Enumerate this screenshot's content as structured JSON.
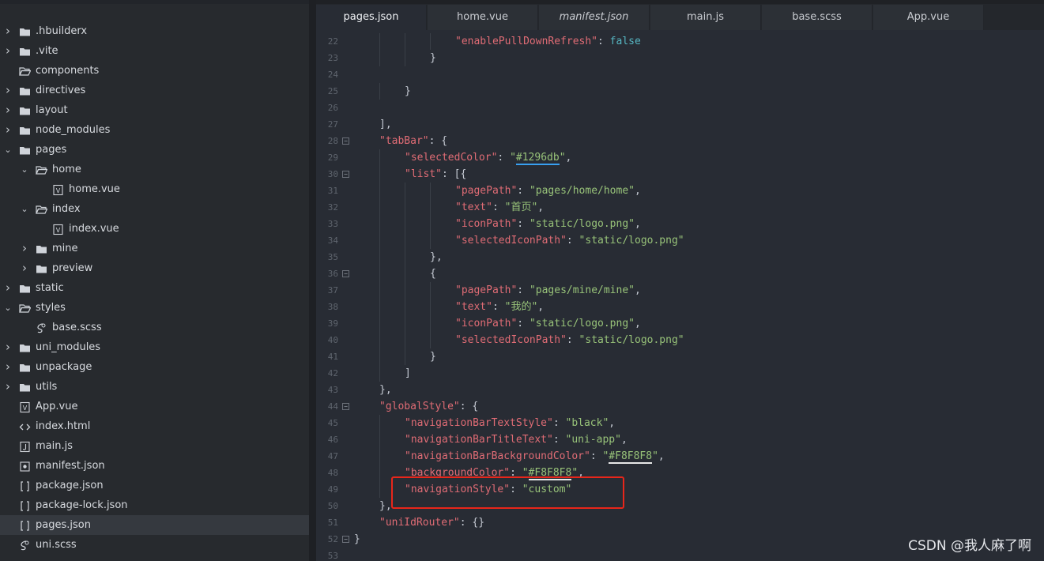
{
  "explorer": {
    "items": [
      {
        "label": ".hbuilderx",
        "type": "folder",
        "expand": "closed",
        "depth": 0
      },
      {
        "label": ".vite",
        "type": "folder",
        "expand": "closed",
        "depth": 0
      },
      {
        "label": "components",
        "type": "folder-open",
        "expand": "none",
        "depth": 0
      },
      {
        "label": "directives",
        "type": "folder",
        "expand": "closed",
        "depth": 0
      },
      {
        "label": "layout",
        "type": "folder",
        "expand": "closed",
        "depth": 0
      },
      {
        "label": "node_modules",
        "type": "folder",
        "expand": "closed",
        "depth": 0
      },
      {
        "label": "pages",
        "type": "folder",
        "expand": "open",
        "depth": 0
      },
      {
        "label": "home",
        "type": "folder-open",
        "expand": "open",
        "depth": 1
      },
      {
        "label": "home.vue",
        "type": "vue",
        "expand": "none",
        "depth": 2
      },
      {
        "label": "index",
        "type": "folder-open",
        "expand": "open",
        "depth": 1
      },
      {
        "label": "index.vue",
        "type": "vue",
        "expand": "none",
        "depth": 2
      },
      {
        "label": "mine",
        "type": "folder",
        "expand": "closed",
        "depth": 1
      },
      {
        "label": "preview",
        "type": "folder",
        "expand": "closed",
        "depth": 1
      },
      {
        "label": "static",
        "type": "folder",
        "expand": "closed",
        "depth": 0
      },
      {
        "label": "styles",
        "type": "folder-open",
        "expand": "open",
        "depth": 0
      },
      {
        "label": "base.scss",
        "type": "scss",
        "expand": "none",
        "depth": 1
      },
      {
        "label": "uni_modules",
        "type": "folder",
        "expand": "closed",
        "depth": 0
      },
      {
        "label": "unpackage",
        "type": "folder",
        "expand": "closed",
        "depth": 0
      },
      {
        "label": "utils",
        "type": "folder",
        "expand": "closed",
        "depth": 0
      },
      {
        "label": "App.vue",
        "type": "vue",
        "expand": "none",
        "depth": 0
      },
      {
        "label": "index.html",
        "type": "html",
        "expand": "none",
        "depth": 0
      },
      {
        "label": "main.js",
        "type": "js",
        "expand": "none",
        "depth": 0
      },
      {
        "label": "manifest.json",
        "type": "manifest",
        "expand": "none",
        "depth": 0
      },
      {
        "label": "package.json",
        "type": "json",
        "expand": "none",
        "depth": 0
      },
      {
        "label": "package-lock.json",
        "type": "json",
        "expand": "none",
        "depth": 0
      },
      {
        "label": "pages.json",
        "type": "json",
        "expand": "none",
        "depth": 0,
        "active": true
      },
      {
        "label": "uni.scss",
        "type": "scss",
        "expand": "none",
        "depth": 0
      }
    ]
  },
  "tabs": [
    {
      "label": "pages.json",
      "active": true,
      "italic": false
    },
    {
      "label": "home.vue",
      "active": false,
      "italic": false
    },
    {
      "label": "manifest.json",
      "active": false,
      "italic": true
    },
    {
      "label": "main.js",
      "active": false,
      "italic": false
    },
    {
      "label": "base.scss",
      "active": false,
      "italic": false
    },
    {
      "label": "App.vue",
      "active": false,
      "italic": false
    }
  ],
  "code": {
    "lines": [
      {
        "n": "22",
        "fold": false,
        "indent": 4,
        "tokens": [
          [
            "k",
            "\"enablePullDownRefresh\""
          ],
          [
            "p",
            ": "
          ],
          [
            "b",
            "false"
          ]
        ]
      },
      {
        "n": "23",
        "fold": false,
        "indent": 3,
        "tokens": [
          [
            "p",
            "}"
          ]
        ]
      },
      {
        "n": "24",
        "fold": false,
        "indent": 0,
        "tokens": []
      },
      {
        "n": "25",
        "fold": false,
        "indent": 2,
        "tokens": [
          [
            "p",
            "}"
          ]
        ]
      },
      {
        "n": "26",
        "fold": false,
        "indent": 0,
        "tokens": []
      },
      {
        "n": "27",
        "fold": false,
        "indent": 1,
        "tokens": [
          [
            "p",
            "],"
          ]
        ]
      },
      {
        "n": "28",
        "fold": true,
        "indent": 1,
        "tokens": [
          [
            "k",
            "\"tabBar\""
          ],
          [
            "p",
            ": {"
          ]
        ]
      },
      {
        "n": "29",
        "fold": false,
        "indent": 2,
        "tokens": [
          [
            "k",
            "\"selectedColor\""
          ],
          [
            "p",
            ": "
          ],
          [
            "s",
            "\""
          ],
          [
            "s-blue",
            "#1296db"
          ],
          [
            "s",
            "\""
          ],
          [
            "p",
            ","
          ]
        ]
      },
      {
        "n": "30",
        "fold": true,
        "indent": 2,
        "tokens": [
          [
            "k",
            "\"list\""
          ],
          [
            "p",
            ": [{"
          ]
        ]
      },
      {
        "n": "31",
        "fold": false,
        "indent": 4,
        "tokens": [
          [
            "k",
            "\"pagePath\""
          ],
          [
            "p",
            ": "
          ],
          [
            "s",
            "\"pages/home/home\""
          ],
          [
            "p",
            ","
          ]
        ]
      },
      {
        "n": "32",
        "fold": false,
        "indent": 4,
        "tokens": [
          [
            "k",
            "\"text\""
          ],
          [
            "p",
            ": "
          ],
          [
            "s",
            "\"首页\""
          ],
          [
            "p",
            ","
          ]
        ]
      },
      {
        "n": "33",
        "fold": false,
        "indent": 4,
        "tokens": [
          [
            "k",
            "\"iconPath\""
          ],
          [
            "p",
            ": "
          ],
          [
            "s",
            "\"static/logo.png\""
          ],
          [
            "p",
            ","
          ]
        ]
      },
      {
        "n": "34",
        "fold": false,
        "indent": 4,
        "tokens": [
          [
            "k",
            "\"selectedIconPath\""
          ],
          [
            "p",
            ": "
          ],
          [
            "s",
            "\"static/logo.png\""
          ]
        ]
      },
      {
        "n": "35",
        "fold": false,
        "indent": 3,
        "tokens": [
          [
            "p",
            "},"
          ]
        ]
      },
      {
        "n": "36",
        "fold": true,
        "indent": 3,
        "tokens": [
          [
            "p",
            "{"
          ]
        ]
      },
      {
        "n": "37",
        "fold": false,
        "indent": 4,
        "tokens": [
          [
            "k",
            "\"pagePath\""
          ],
          [
            "p",
            ": "
          ],
          [
            "s",
            "\"pages/mine/mine\""
          ],
          [
            "p",
            ","
          ]
        ]
      },
      {
        "n": "38",
        "fold": false,
        "indent": 4,
        "tokens": [
          [
            "k",
            "\"text\""
          ],
          [
            "p",
            ": "
          ],
          [
            "s",
            "\"我的\""
          ],
          [
            "p",
            ","
          ]
        ]
      },
      {
        "n": "39",
        "fold": false,
        "indent": 4,
        "tokens": [
          [
            "k",
            "\"iconPath\""
          ],
          [
            "p",
            ": "
          ],
          [
            "s",
            "\"static/logo.png\""
          ],
          [
            "p",
            ","
          ]
        ]
      },
      {
        "n": "40",
        "fold": false,
        "indent": 4,
        "tokens": [
          [
            "k",
            "\"selectedIconPath\""
          ],
          [
            "p",
            ": "
          ],
          [
            "s",
            "\"static/logo.png\""
          ]
        ]
      },
      {
        "n": "41",
        "fold": false,
        "indent": 3,
        "tokens": [
          [
            "p",
            "}"
          ]
        ]
      },
      {
        "n": "42",
        "fold": false,
        "indent": 2,
        "tokens": [
          [
            "p",
            "]"
          ]
        ]
      },
      {
        "n": "43",
        "fold": false,
        "indent": 1,
        "tokens": [
          [
            "p",
            "},"
          ]
        ]
      },
      {
        "n": "44",
        "fold": true,
        "indent": 1,
        "tokens": [
          [
            "k",
            "\"globalStyle\""
          ],
          [
            "p",
            ": {"
          ]
        ]
      },
      {
        "n": "45",
        "fold": false,
        "indent": 2,
        "tokens": [
          [
            "k",
            "\"navigationBarTextStyle\""
          ],
          [
            "p",
            ": "
          ],
          [
            "s",
            "\"black\""
          ],
          [
            "p",
            ","
          ]
        ]
      },
      {
        "n": "46",
        "fold": false,
        "indent": 2,
        "tokens": [
          [
            "k",
            "\"navigationBarTitleText\""
          ],
          [
            "p",
            ": "
          ],
          [
            "s",
            "\"uni-app\""
          ],
          [
            "p",
            ","
          ]
        ]
      },
      {
        "n": "47",
        "fold": false,
        "indent": 2,
        "tokens": [
          [
            "k",
            "\"navigationBarBackgroundColor\""
          ],
          [
            "p",
            ": "
          ],
          [
            "s",
            "\""
          ],
          [
            "s-white",
            "#F8F8F8"
          ],
          [
            "s",
            "\""
          ],
          [
            "p",
            ","
          ]
        ]
      },
      {
        "n": "48",
        "fold": false,
        "indent": 2,
        "tokens": [
          [
            "k",
            "\"backgroundColor\""
          ],
          [
            "p",
            ": "
          ],
          [
            "s",
            "\""
          ],
          [
            "s-white",
            "#F8F8F8"
          ],
          [
            "s",
            "\""
          ],
          [
            "p",
            ","
          ]
        ]
      },
      {
        "n": "49",
        "fold": false,
        "indent": 2,
        "tokens": [
          [
            "k",
            "\"navigationStyle\""
          ],
          [
            "p",
            ": "
          ],
          [
            "s",
            "\"custom\""
          ]
        ]
      },
      {
        "n": "50",
        "fold": false,
        "indent": 1,
        "tokens": [
          [
            "p",
            "},"
          ]
        ]
      },
      {
        "n": "51",
        "fold": false,
        "indent": 1,
        "tokens": [
          [
            "k",
            "\"uniIdRouter\""
          ],
          [
            "p",
            ": {}"
          ]
        ]
      },
      {
        "n": "52",
        "fold": true,
        "indent": 0,
        "tokens": [
          [
            "p",
            "}"
          ]
        ]
      },
      {
        "n": "53",
        "fold": false,
        "indent": 0,
        "tokens": []
      }
    ]
  },
  "watermark": "CSDN @我人麻了啊",
  "colors": {
    "highlight_box": "#e8261a",
    "key": "#e06c75",
    "string": "#98c379",
    "boolean": "#56b6c2"
  }
}
